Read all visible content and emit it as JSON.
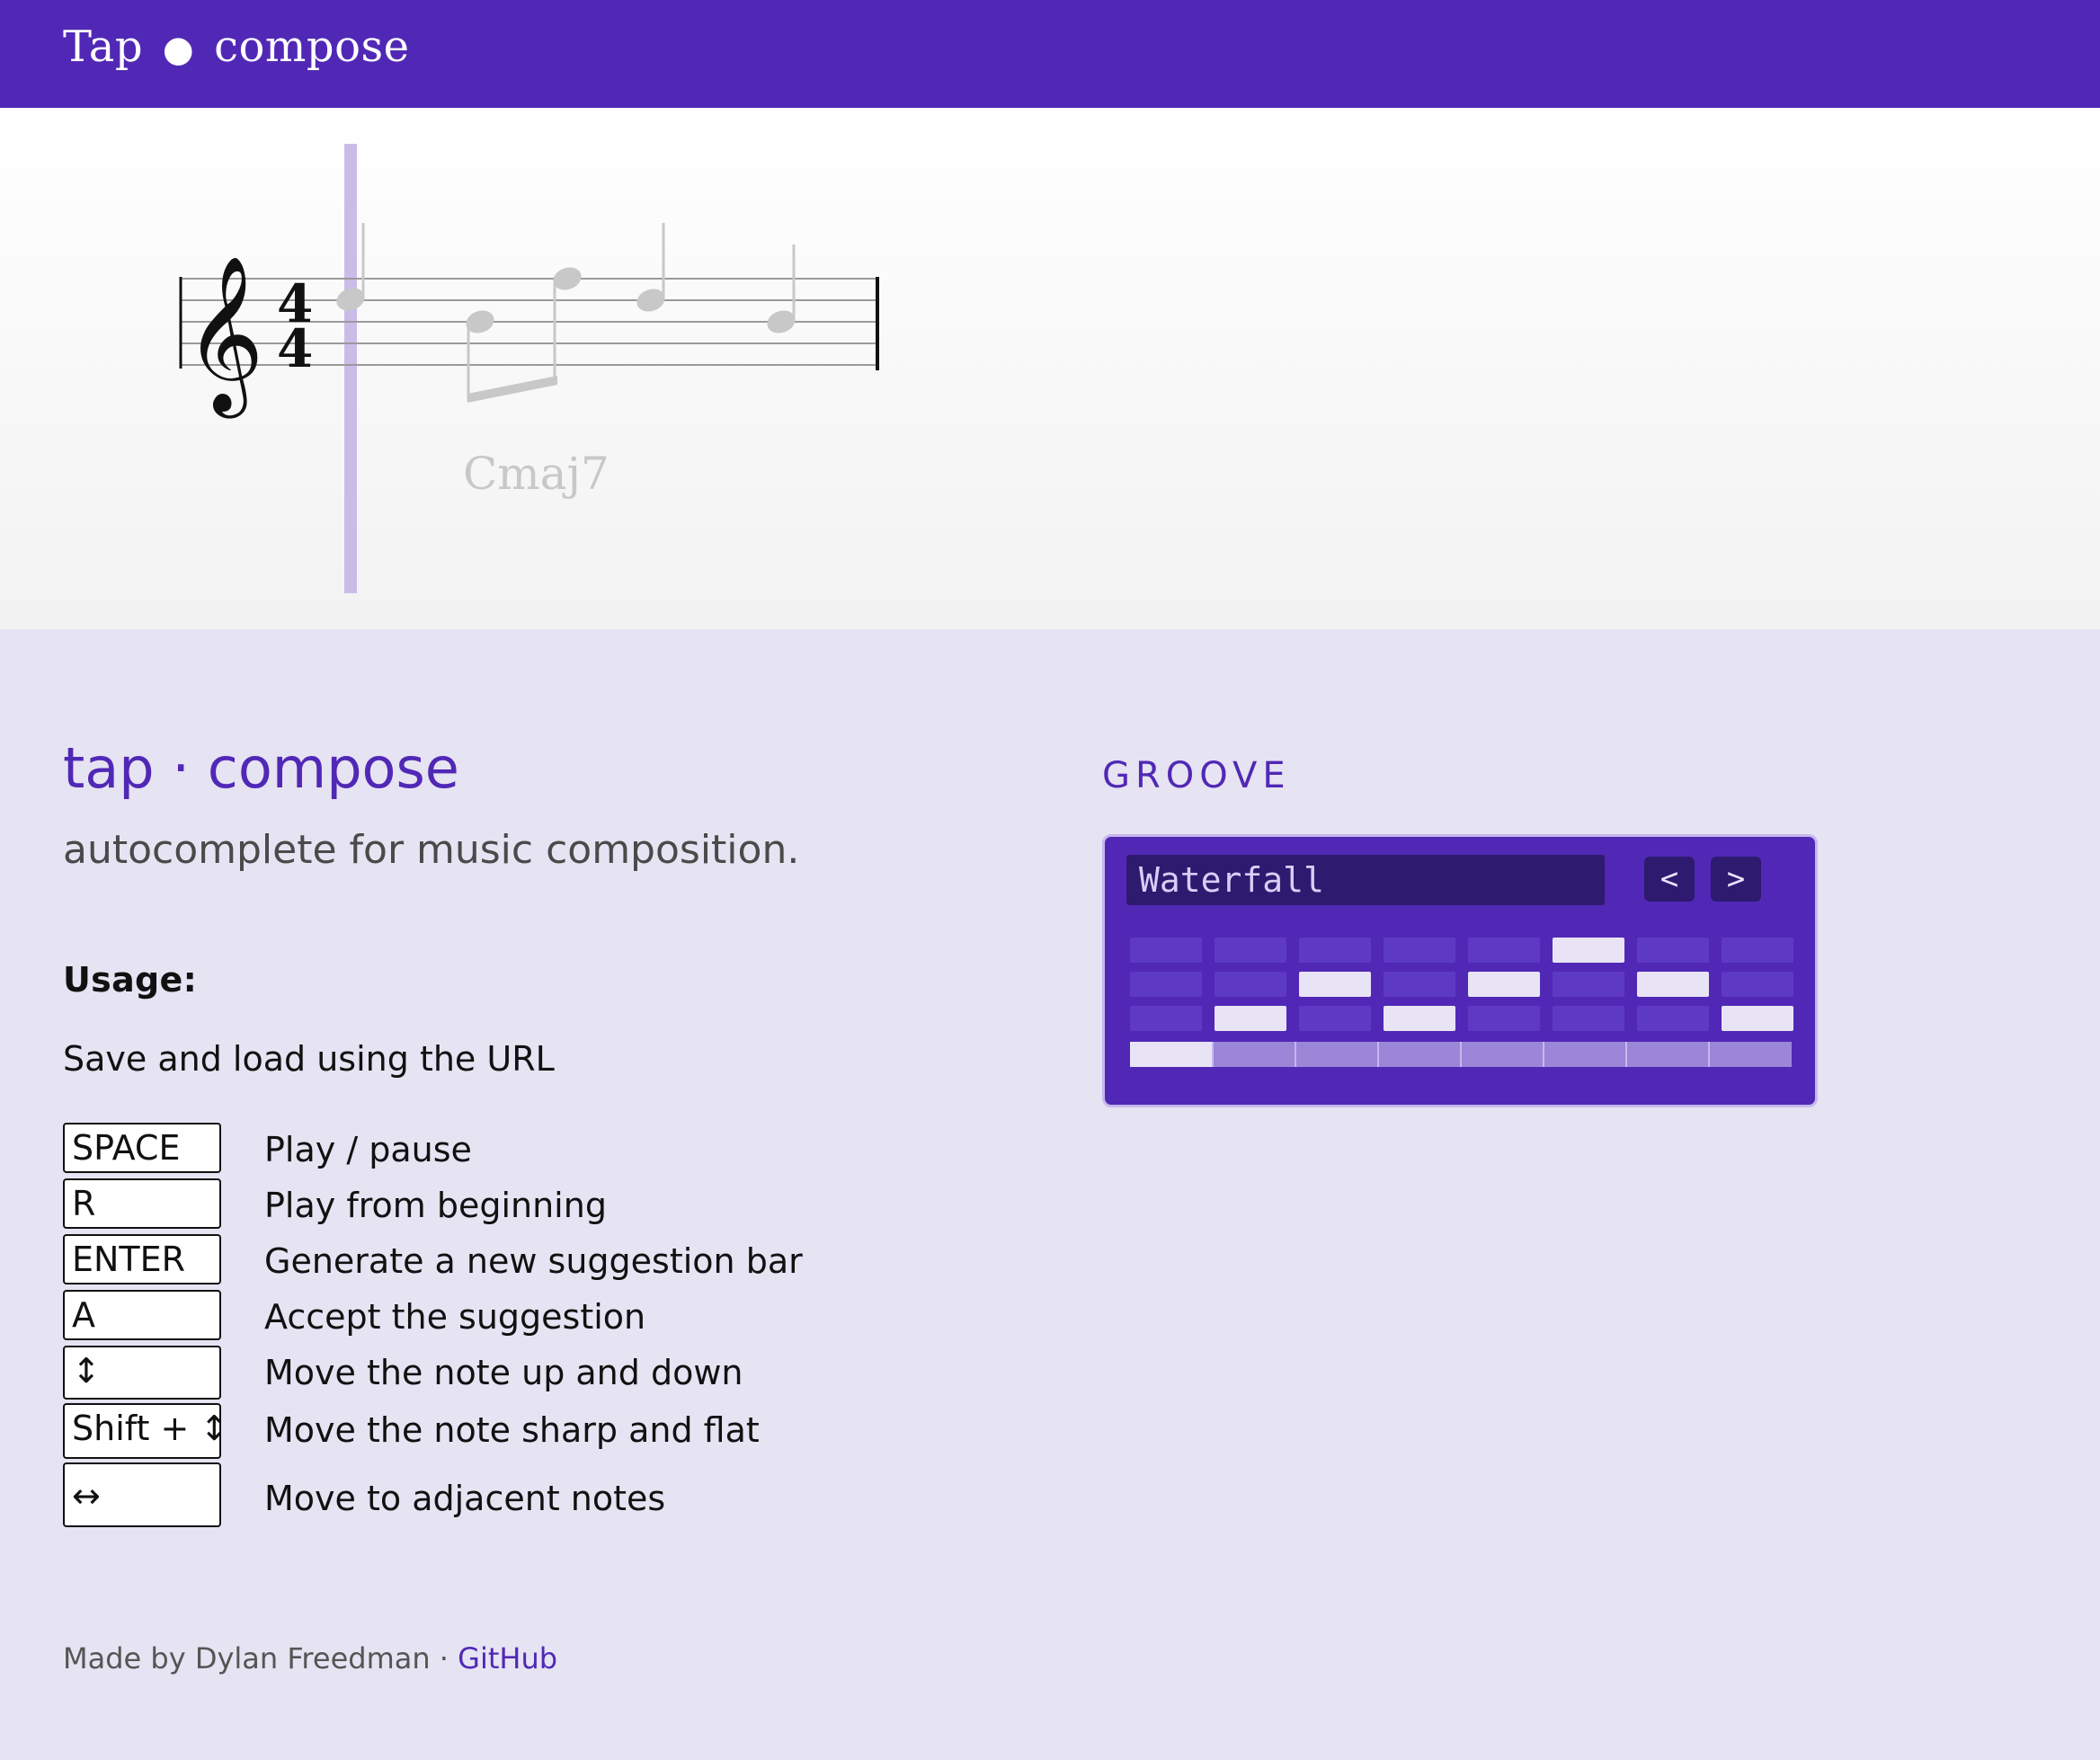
{
  "header": {
    "brand_left": "Tap",
    "brand_sep": "●",
    "brand_right": "compose"
  },
  "score": {
    "clef": "treble-clef",
    "time_signature": "4/4",
    "chord_symbol": "Cmaj7"
  },
  "intro": {
    "title": "tap · compose",
    "tagline": "autocomplete for music composition."
  },
  "usage": {
    "heading": "Usage:",
    "note": "Save and load using the URL",
    "shortcuts": [
      {
        "key": "SPACE",
        "desc": "Play / pause"
      },
      {
        "key": "R",
        "desc": "Play from beginning"
      },
      {
        "key": "ENTER",
        "desc": "Generate a new suggestion bar"
      },
      {
        "key": "A",
        "desc": "Accept the suggestion"
      },
      {
        "key": "↕",
        "desc": "Move the note up and down"
      },
      {
        "key": "Shift + ↕",
        "desc": "Move the note sharp and flat"
      },
      {
        "key": "↔",
        "desc": "Move to adjacent notes"
      }
    ]
  },
  "groove": {
    "label": "GROOVE",
    "pattern_name": "Waterfall",
    "prev_label": "<",
    "next_label": ">",
    "rows": [
      [
        0,
        0,
        0,
        0,
        0,
        1,
        0,
        0
      ],
      [
        0,
        0,
        1,
        0,
        1,
        0,
        1,
        0
      ],
      [
        0,
        1,
        0,
        1,
        0,
        0,
        0,
        1
      ]
    ],
    "progress_step": 1,
    "steps": 8,
    "colors": {
      "panel": "#5128b6",
      "cell_off": "#5e3ac4",
      "cell_on": "#e8e4f6"
    }
  },
  "footer": {
    "made_by": "Made by Dylan Freedman",
    "sep": "·",
    "link": "GitHub"
  }
}
